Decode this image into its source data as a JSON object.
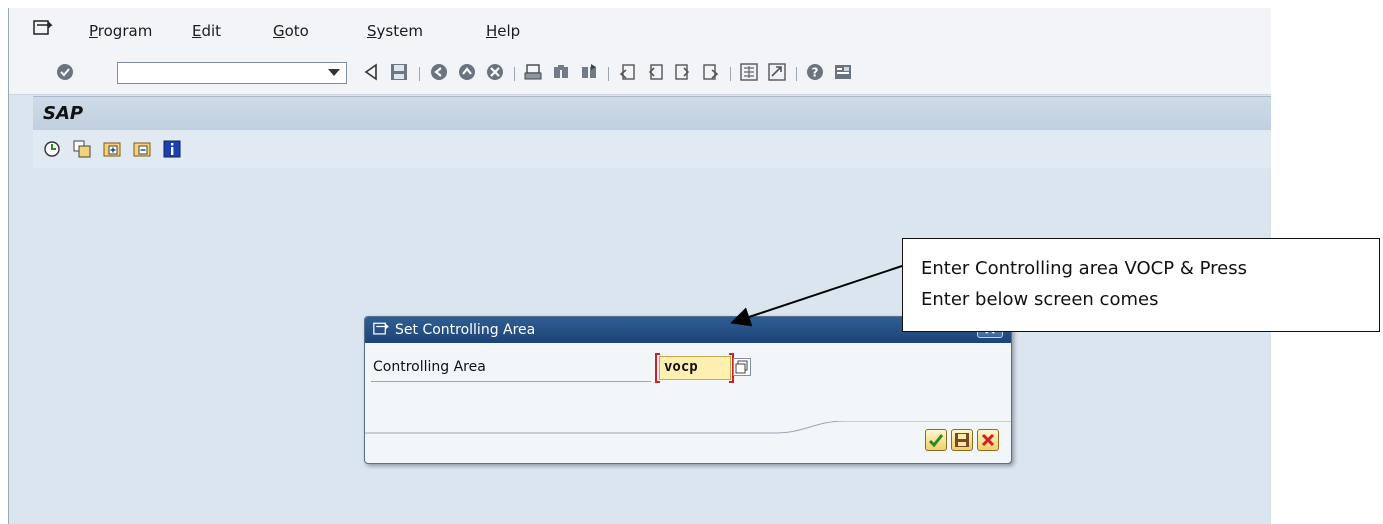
{
  "menu": {
    "items": [
      {
        "label": "Program"
      },
      {
        "label": "Edit"
      },
      {
        "label": "Goto"
      },
      {
        "label": "System"
      },
      {
        "label": "Help"
      }
    ]
  },
  "toolbar": {
    "command_field_value": "",
    "icons": [
      "enter-icon",
      "back-icon",
      "save-icon",
      "back-green-icon",
      "exit-icon",
      "cancel-icon",
      "print-icon",
      "find-icon",
      "find-next-icon",
      "first-page-icon",
      "previous-page-icon",
      "next-page-icon",
      "last-page-icon",
      "create-session-icon",
      "shortcut-icon",
      "help-icon",
      "customize-layout-icon"
    ]
  },
  "screen": {
    "title": "SAP"
  },
  "app_toolbar": {
    "icons": [
      "clock-icon",
      "copy-icon",
      "expand-icon",
      "collapse-icon",
      "info-icon"
    ]
  },
  "dialog": {
    "title": "Set Controlling Area",
    "field_label": "Controlling Area",
    "field_value": "vocp",
    "buttons": [
      "confirm-icon",
      "save-icon",
      "cancel-icon"
    ]
  },
  "callout": {
    "line1": "Enter Controlling area VOCP & Press",
    "line2": "Enter below screen comes"
  },
  "colors": {
    "dialog_title_bg": "#1d4477",
    "background": "#dbe5ef",
    "input_bg": "#fdf0b0",
    "required_marker": "#d21f1f"
  }
}
